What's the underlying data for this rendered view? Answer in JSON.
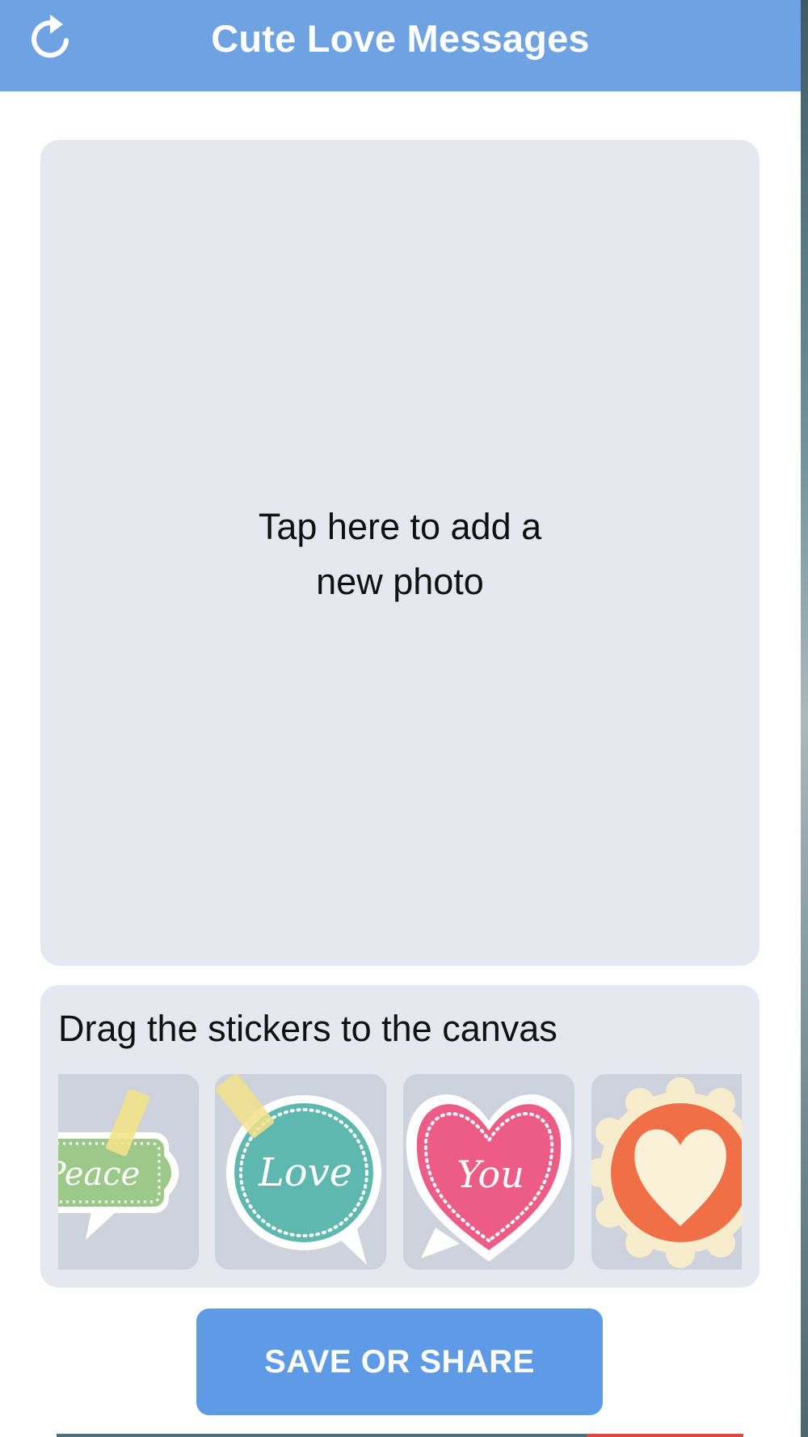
{
  "header": {
    "title": "Cute Love Messages",
    "refresh_icon": "refresh-icon",
    "background": "#6fa2e2"
  },
  "canvas": {
    "hint": "Tap here to add a\nnew photo"
  },
  "stickers": {
    "label": "Drag the stickers to the canvas",
    "items": [
      {
        "text": "Peace",
        "shape": "tag",
        "color": "#9cc98a"
      },
      {
        "text": "Love",
        "shape": "circle-bubble",
        "color": "#5fb8b0"
      },
      {
        "text": "You",
        "shape": "heart-bubble",
        "color": "#ec5c86"
      },
      {
        "text": "",
        "shape": "scalloped-heart",
        "color": "#f06f47"
      }
    ]
  },
  "actions": {
    "save_label": "SAVE OR SHARE",
    "accent": "#5f9ae6"
  }
}
